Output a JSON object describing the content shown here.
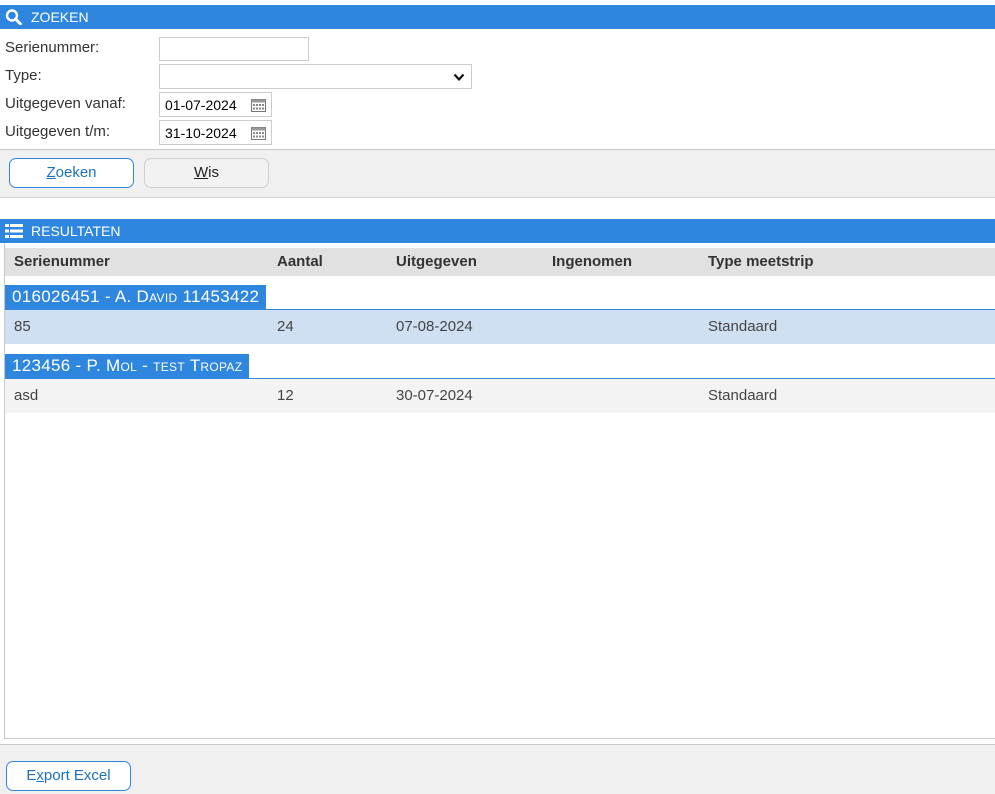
{
  "search": {
    "title": "ZOEKEN",
    "icon": "search-icon",
    "fields": {
      "serial_label": "Serienummer:",
      "serial_value": "",
      "type_label": "Type:",
      "type_value": "",
      "from_label": "Uitgegeven vanaf:",
      "from_value": "01-07-2024",
      "to_label": "Uitgegeven t/m:",
      "to_value": "31-10-2024"
    },
    "buttons": {
      "search_accel": "Z",
      "search_rest": "oeken",
      "clear_accel": "W",
      "clear_rest": "is"
    }
  },
  "results": {
    "title": "RESULTATEN",
    "icon": "list-icon",
    "columns": [
      "Serienummer",
      "Aantal",
      "Uitgegeven",
      "Ingenomen",
      "Type meetstrip"
    ],
    "groups": [
      {
        "label": "016026451 - A. David 11453422",
        "rows": [
          {
            "serial": "85",
            "count": "24",
            "issued": "07-08-2024",
            "returned": "",
            "type": "Standaard"
          }
        ]
      },
      {
        "label": "123456 - P. Mol - test Tropaz",
        "rows": [
          {
            "serial": "asd",
            "count": "12",
            "issued": "30-07-2024",
            "returned": "",
            "type": "Standaard"
          }
        ]
      }
    ]
  },
  "footer": {
    "export_pre": "E",
    "export_accel": "x",
    "export_rest": "port Excel"
  },
  "colors": {
    "accent": "#2e86de",
    "selected_row": "#cfe0f3",
    "header_row": "#e1e1e1"
  }
}
